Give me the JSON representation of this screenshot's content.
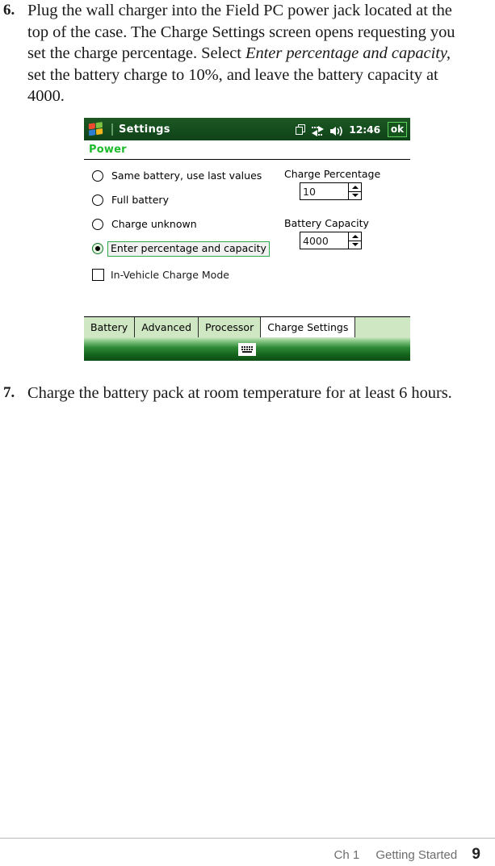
{
  "document": {
    "steps": [
      {
        "number": "6.",
        "text_html": "Plug the wall charger into the Field PC power jack located at the top of the case. The Charge Settings screen opens requesting you set the charge percentage. Select <i>Enter percentage and capacity,</i> set the battery charge to 10%, and leave the battery capacity at 4000."
      },
      {
        "number": "7.",
        "text_html": "Charge the battery pack at room temperature for at least 6 hours."
      }
    ],
    "footer": {
      "chapter": "Ch 1",
      "section": "Getting Started",
      "page_number": "9"
    }
  },
  "screenshot": {
    "titlebar": {
      "logo": "windows-flag-logo",
      "title": "Settings",
      "icons": [
        "windows-stack-icon",
        "connectivity-icon",
        "volume-icon"
      ],
      "clock": "12:46",
      "ok_label": "ok",
      "background_color": "#17501f"
    },
    "page_header": {
      "title": "Power",
      "color": "#1dbb2b"
    },
    "radio_group": {
      "options": [
        {
          "label": "Same battery, use last values",
          "selected": false
        },
        {
          "label": "Full battery",
          "selected": false
        },
        {
          "label": "Charge unknown",
          "selected": false
        },
        {
          "label": "Enter percentage and capacity",
          "selected": true
        }
      ]
    },
    "checkbox": {
      "label": "In-Vehicle Charge Mode",
      "checked": false
    },
    "fields": [
      {
        "label": "Charge Percentage",
        "value": "10"
      },
      {
        "label": "Battery Capacity",
        "value": "4000"
      }
    ],
    "tabs": [
      {
        "label": "Battery",
        "active": false
      },
      {
        "label": "Advanced",
        "active": false
      },
      {
        "label": "Processor",
        "active": false
      },
      {
        "label": "Charge Settings",
        "active": true
      }
    ],
    "taskbar": {
      "sip_icon": "keyboard-icon"
    },
    "accent_colors": {
      "titlebar_green": "#17501f",
      "header_green": "#1dbb2b",
      "tab_green": "#cfe7c2",
      "focus_green": "#2faa4a"
    }
  }
}
